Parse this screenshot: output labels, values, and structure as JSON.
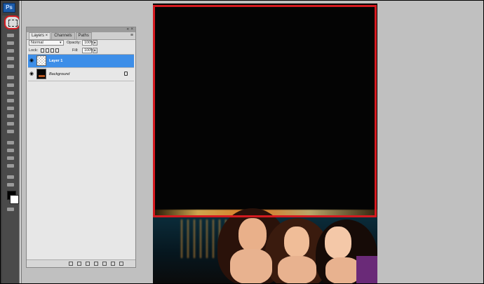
{
  "app": {
    "logo_text": "Ps"
  },
  "toolbar": {
    "selected_tool": "rectangular-marquee",
    "highlight_color": "#d41a20",
    "tools": [
      "move",
      "lasso",
      "quick-select",
      "crop",
      "eyedropper",
      "healing",
      "brush",
      "clone-stamp",
      "history-brush",
      "eraser",
      "gradient",
      "blur",
      "dodge",
      "pen",
      "type",
      "path-select",
      "shape",
      "hand",
      "zoom"
    ]
  },
  "layers_panel": {
    "tabs": [
      {
        "label": "Layers ×",
        "active": true
      },
      {
        "label": "Channels",
        "active": false
      },
      {
        "label": "Paths",
        "active": false
      }
    ],
    "blend_mode": "Normal",
    "opacity_label": "Opacity:",
    "opacity_value": "100%",
    "lock_label": "Lock:",
    "fill_label": "Fill:",
    "fill_value": "100%",
    "layers": [
      {
        "name": "Layer 1",
        "selected": true,
        "visible": true,
        "thumbnail": "transparent"
      },
      {
        "name": "Background",
        "selected": false,
        "visible": true,
        "thumbnail": "photo",
        "locked": true
      }
    ]
  },
  "document": {
    "content": "night-photo",
    "crop_highlight_color": "#d41a20"
  }
}
